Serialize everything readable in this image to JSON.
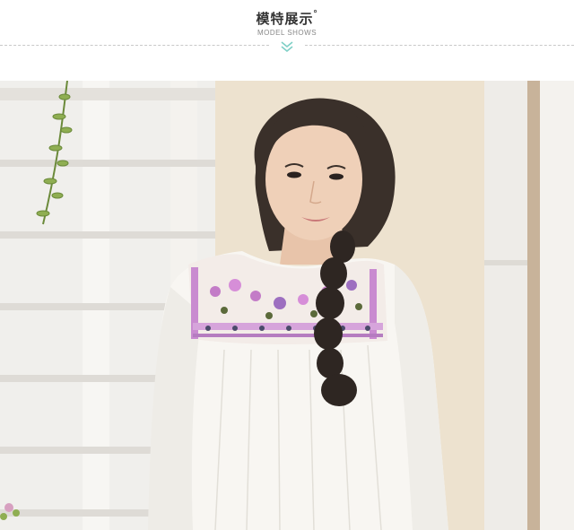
{
  "header": {
    "title": "模特展示",
    "title_mark": "°",
    "subtitle": "MODEL SHOWS",
    "accent_color": "#7ecfc6"
  },
  "photo": {
    "subject": "model-in-white-embroidered-blouse"
  }
}
